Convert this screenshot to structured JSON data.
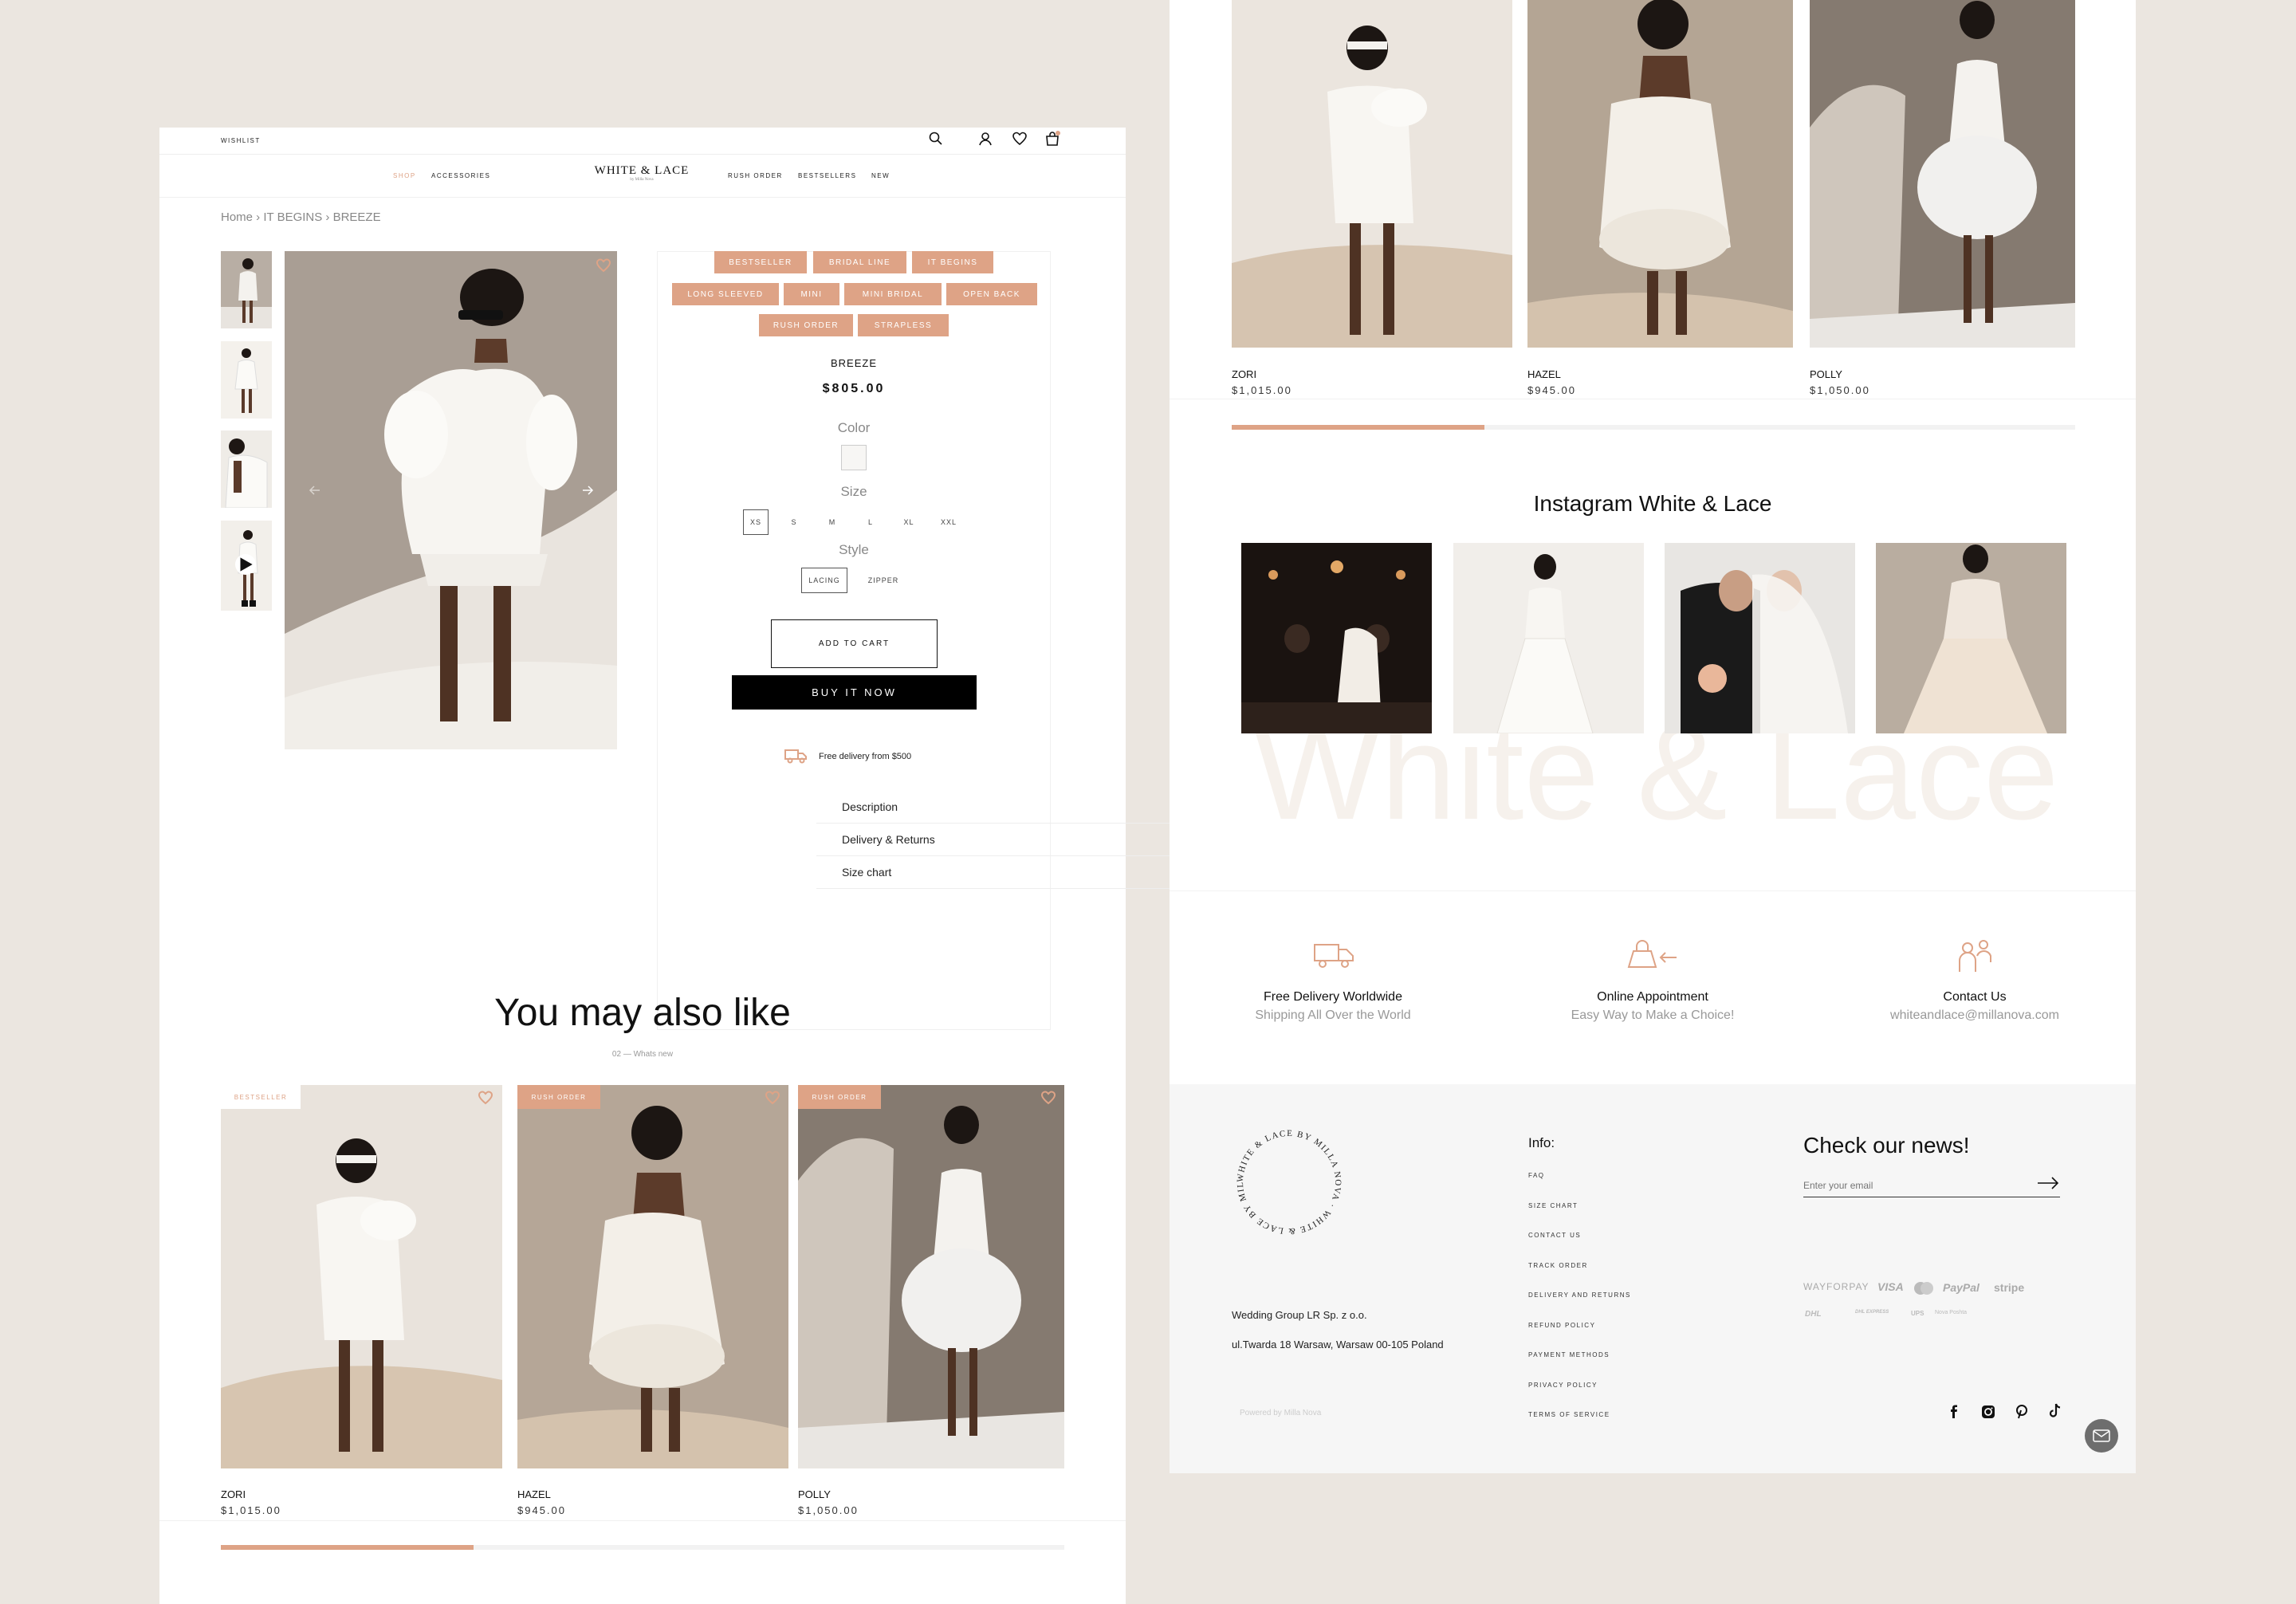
{
  "header": {
    "wishlist_label": "WISHLIST",
    "logo_title": "WHITE & LACE",
    "logo_sub": "by Milla Nova",
    "nav_left": [
      "SHOP",
      "ACCESSORIES"
    ],
    "nav_right": [
      "RUSH ORDER",
      "BESTSELLERS",
      "NEW"
    ]
  },
  "breadcrumb": "Home › IT BEGINS › BREEZE",
  "product": {
    "tags": [
      "BESTSELLER",
      "BRIDAL LINE",
      "IT BEGINS",
      "LONG SLEEVED",
      "MINI",
      "MINI BRIDAL",
      "OPEN BACK",
      "RUSH ORDER",
      "STRAPLESS"
    ],
    "name": "BREEZE",
    "price": "$805.00",
    "color_label": "Color",
    "size_label": "Size",
    "sizes": [
      "XS",
      "S",
      "M",
      "L",
      "XL",
      "XXL"
    ],
    "selected_size": "XS",
    "style_label": "Style",
    "styles": [
      "LACING",
      "ZIPPER"
    ],
    "selected_style": "LACING",
    "add_to_cart": "ADD TO CART",
    "buy_now": "BUY IT NOW",
    "delivery_note": "Free delivery from $500",
    "accordion": [
      "Description",
      "Delivery & Returns",
      "Size chart"
    ]
  },
  "also_like": {
    "title": "You may also like",
    "subtitle": "02 — Whats new",
    "items": [
      {
        "name": "ZORI",
        "price": "$1,015.00",
        "badge": "BESTSELLER"
      },
      {
        "name": "HAZEL",
        "price": "$945.00",
        "badge": "RUSH ORDER"
      },
      {
        "name": "POLLY",
        "price": "$1,050.00",
        "badge": "RUSH ORDER"
      }
    ],
    "slider_progress": 0.3
  },
  "right_carousel": {
    "items": [
      {
        "name": "ZORI",
        "price": "$1,015.00"
      },
      {
        "name": "HAZEL",
        "price": "$945.00"
      },
      {
        "name": "POLLY",
        "price": "$1,050.00"
      }
    ],
    "slider_progress": 0.3
  },
  "instagram": {
    "title": "Instagram White & Lace",
    "watermark": "White & Lace"
  },
  "features": [
    {
      "title": "Free Delivery Worldwide",
      "subtitle": "Shipping All Over the World",
      "icon": "truck-icon"
    },
    {
      "title": "Online Appointment",
      "subtitle": "Easy Way to Make a Choice!",
      "icon": "shopping-bag-icon"
    },
    {
      "title": "Contact Us",
      "subtitle": "whiteandlace@millanova.com",
      "icon": "people-icon"
    }
  ],
  "footer": {
    "seal_text": "WHITE & LACE BY MILLA NOVA · WHITE & LACE BY MILLA NOVA ·",
    "company": "Wedding Group LR Sp. z o.o.",
    "address": "ul.Twarda 18 Warsaw, Warsaw 00-105 Poland",
    "powered": "Powered by Milla Nova",
    "info_title": "Info:",
    "info_links": [
      "FAQ",
      "SIZE CHART",
      "CONTACT US",
      "TRACK ORDER",
      "DELIVERY AND RETURNS",
      "REFUND POLICY",
      "PAYMENT METHODS",
      "PRIVACY POLICY",
      "TERMS OF SERVICE"
    ],
    "news_title": "Check our news!",
    "email_placeholder": "Enter your email",
    "payments": [
      "WAYFORPAY",
      "VISA",
      "PayPal",
      "stripe"
    ],
    "shipping": [
      "DHL",
      "DHL EXPRESS",
      "UPS",
      "Nova Poshta"
    ]
  },
  "colors": {
    "accent": "#dea386",
    "bg": "#ebe6e0",
    "footer_bg": "#f6f6f6"
  }
}
